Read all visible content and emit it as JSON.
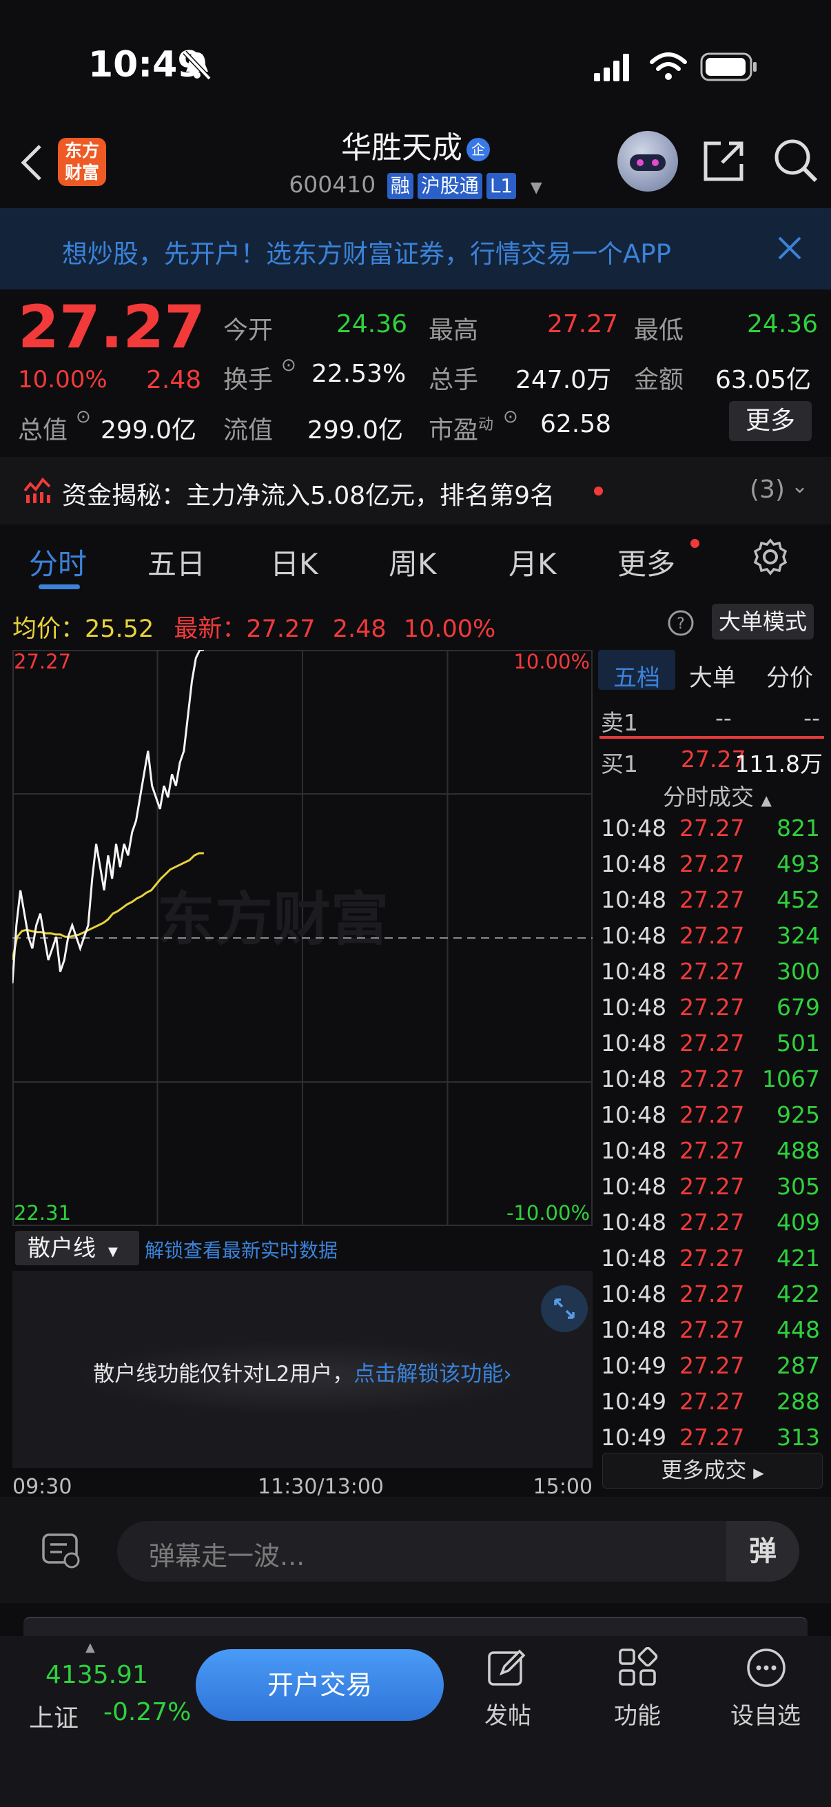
{
  "status": {
    "time": "10:49"
  },
  "header": {
    "logo_line1": "东方",
    "logo_line2": "财富",
    "stock_name": "华胜天成",
    "qi_badge": "企",
    "code": "600410",
    "tags": [
      "融",
      "沪股通",
      "L1"
    ]
  },
  "banner": {
    "text": "想炒股，先开户！选东方财富证券，行情交易一个APP"
  },
  "quote": {
    "price": "27.27",
    "change_pct": "10.00%",
    "change": "2.48",
    "open_label": "今开",
    "open": "24.36",
    "high_label": "最高",
    "high": "27.27",
    "low_label": "最低",
    "low": "24.36",
    "turnover_label": "换手",
    "turnover": "22.53%",
    "volume_label": "总手",
    "volume": "247.0万",
    "amount_label": "金额",
    "amount": "63.05亿",
    "mktcap_label": "总值",
    "mktcap": "299.0亿",
    "float_label": "流值",
    "float": "299.0亿",
    "pe_label": "市盈",
    "pe_sup": "动",
    "pe": "62.58",
    "more": "更多"
  },
  "funds": {
    "text": "资金揭秘：主力净流入5.08亿元，排名第9名",
    "count": "(3)"
  },
  "tabs": [
    "分时",
    "五日",
    "日K",
    "周K",
    "月K",
    "更多"
  ],
  "info": {
    "avg_label": "均价：",
    "avg": "25.52",
    "latest_label": "最新：",
    "latest": "27.27",
    "latest_chg": "2.48",
    "latest_pct": "10.00%",
    "big_order_mode": "大单模式"
  },
  "chart_labels": {
    "top_price": "27.27",
    "top_pct": "10.00%",
    "bottom_price": "22.31",
    "bottom_pct": "-10.00%",
    "watermark": "东方财富",
    "time_start": "09:30",
    "time_mid": "11:30/13:00",
    "time_end": "15:00"
  },
  "chart_data": {
    "type": "line",
    "ylim": [
      22.31,
      27.27
    ],
    "prev_close": 24.79,
    "series": [
      {
        "values": [
          24.4,
          24.9,
          25.2,
          25.0,
          24.8,
          24.7,
          24.9,
          25.0,
          24.8,
          24.6,
          24.7,
          24.8,
          24.5,
          24.6,
          24.8,
          24.9,
          24.8,
          24.7,
          24.8,
          24.9,
          25.3,
          25.6,
          25.4,
          25.2,
          25.5,
          25.3,
          25.6,
          25.4,
          25.6,
          25.5,
          25.7,
          25.8,
          26.0,
          26.2,
          26.4,
          26.1,
          26.0,
          25.9,
          26.1,
          26.0,
          26.2,
          26.1,
          26.3,
          26.4,
          26.7,
          27.0,
          27.2,
          27.27,
          27.27
        ]
      },
      {
        "values": [
          24.6,
          24.8,
          24.85,
          24.86,
          24.85,
          24.84,
          24.84,
          24.83,
          24.83,
          24.82,
          24.82,
          24.8,
          24.8,
          24.81,
          24.82,
          24.84,
          24.86,
          24.88,
          24.9,
          24.92,
          24.95,
          25.0,
          25.02,
          25.05,
          25.08,
          25.1,
          25.13,
          25.15,
          25.18,
          25.2,
          25.25,
          25.3,
          25.34,
          25.38,
          25.4,
          25.42,
          25.44,
          25.46,
          25.5,
          25.52,
          25.52
        ]
      }
    ]
  },
  "orderbook": {
    "tabs": [
      "五档",
      "大单",
      "分价"
    ],
    "sell1": {
      "label": "卖1",
      "price": "--",
      "vol": "--"
    },
    "buy1": {
      "label": "买1",
      "price": "27.27",
      "vol": "111.8万"
    },
    "trades_title": "分时成交",
    "trades": [
      {
        "t": "10:48",
        "p": "27.27",
        "v": "821"
      },
      {
        "t": "10:48",
        "p": "27.27",
        "v": "493"
      },
      {
        "t": "10:48",
        "p": "27.27",
        "v": "452"
      },
      {
        "t": "10:48",
        "p": "27.27",
        "v": "324"
      },
      {
        "t": "10:48",
        "p": "27.27",
        "v": "300"
      },
      {
        "t": "10:48",
        "p": "27.27",
        "v": "679"
      },
      {
        "t": "10:48",
        "p": "27.27",
        "v": "501"
      },
      {
        "t": "10:48",
        "p": "27.27",
        "v": "1067"
      },
      {
        "t": "10:48",
        "p": "27.27",
        "v": "925"
      },
      {
        "t": "10:48",
        "p": "27.27",
        "v": "488"
      },
      {
        "t": "10:48",
        "p": "27.27",
        "v": "305"
      },
      {
        "t": "10:48",
        "p": "27.27",
        "v": "409"
      },
      {
        "t": "10:48",
        "p": "27.27",
        "v": "421"
      },
      {
        "t": "10:48",
        "p": "27.27",
        "v": "422"
      },
      {
        "t": "10:48",
        "p": "27.27",
        "v": "448"
      },
      {
        "t": "10:49",
        "p": "27.27",
        "v": "287"
      },
      {
        "t": "10:49",
        "p": "27.27",
        "v": "288"
      },
      {
        "t": "10:49",
        "p": "27.27",
        "v": "313"
      }
    ],
    "more_trades": "更多成交"
  },
  "retail": {
    "select": "散户线",
    "unlock_link": "解锁查看最新实时数据",
    "notice": "散户线功能仅针对L2用户，",
    "notice_link": "点击解锁该功能"
  },
  "danmu": {
    "placeholder": "弹幕走一波...",
    "send": "弹"
  },
  "bottom": {
    "index_value": "4135.91",
    "index_name": "上证",
    "index_pct": "-0.27%",
    "open_account": "开户交易",
    "post": "发帖",
    "functions": "功能",
    "watchlist": "设自选"
  }
}
